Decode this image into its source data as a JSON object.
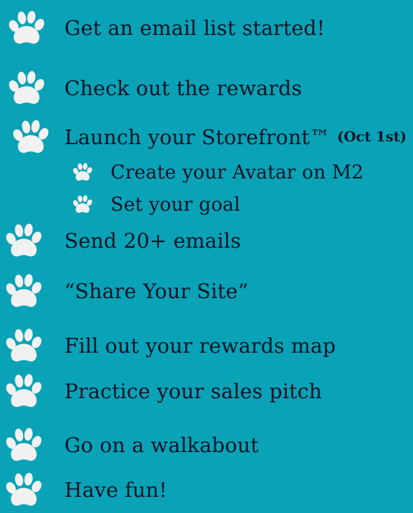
{
  "colors": {
    "background": "#0aa2b6",
    "text": "#0b1426",
    "paw": "#f1f1f1"
  },
  "icons": {
    "bullet": "paw-print-icon"
  },
  "items": [
    {
      "label": "Get an email list started!"
    },
    {
      "label": "Check out the rewards"
    },
    {
      "label": "Launch your Storefront™",
      "note": "(Oct 1st)"
    },
    {
      "label": "Create your Avatar on M2"
    },
    {
      "label": "Set your goal"
    },
    {
      "label": "Send 20+ emails"
    },
    {
      "label": "“Share Your Site”"
    },
    {
      "label": "Fill out your rewards map"
    },
    {
      "label": "Practice your sales pitch"
    },
    {
      "label": "Go on a walkabout"
    },
    {
      "label": "Have fun!"
    }
  ]
}
